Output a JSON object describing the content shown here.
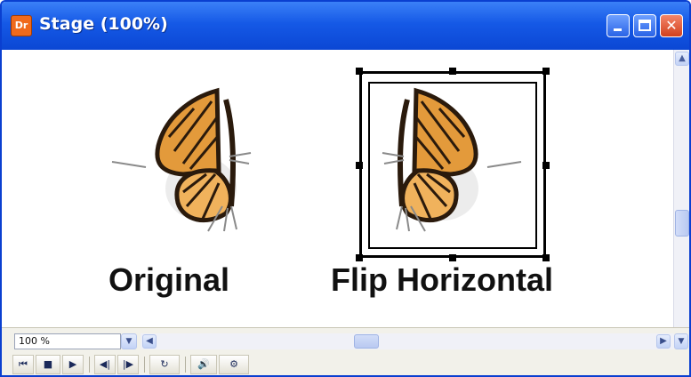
{
  "window": {
    "title": "Stage (100%)",
    "app_icon_text": "Dr",
    "title_color": "#1559e6",
    "close_color": "#d2411d"
  },
  "stage": {
    "grid_hint": "· · · · · · · · · · · ·",
    "left_caption": "Original",
    "right_caption": "Flip Horizontal"
  },
  "statusbar": {
    "zoom_value": "100 %",
    "icons": {
      "zoom_dropdown": "chevron-down-icon",
      "rewind": "rewind-icon",
      "stop": "stop-icon",
      "play": "play-icon",
      "step_back": "step-back-icon",
      "step_forward": "step-forward-icon",
      "loop": "loop-icon",
      "sound": "speaker-icon",
      "options": "options-icon"
    }
  }
}
